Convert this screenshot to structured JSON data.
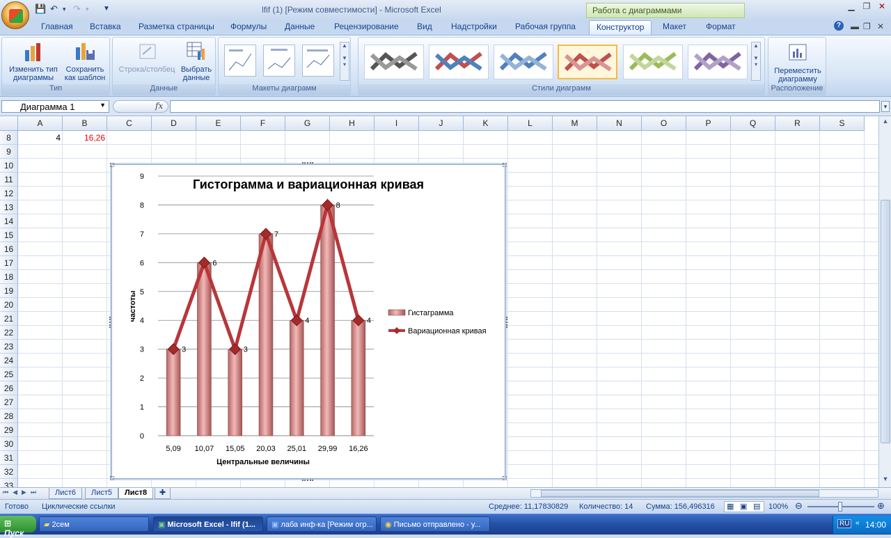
{
  "title_bar": {
    "window_title": "lfif (1)  [Режим совместимости] - Microsoft Excel",
    "context_header": "Работа с диаграммами"
  },
  "tabs": [
    "Главная",
    "Вставка",
    "Разметка страницы",
    "Формулы",
    "Данные",
    "Рецензирование",
    "Вид",
    "Надстройки",
    "Рабочая группа",
    "Конструктор",
    "Макет",
    "Формат"
  ],
  "ribbon": {
    "type_group": {
      "label": "Тип",
      "change_type": "Изменить тип\nдиаграммы",
      "save_template": "Сохранить\nкак шаблон"
    },
    "data_group": {
      "label": "Данные",
      "switch_row_col": "Строка/столбец",
      "select_data": "Выбрать\nданные"
    },
    "layouts_group": {
      "label": "Макеты диаграмм"
    },
    "styles_group": {
      "label": "Стили диаграмм",
      "style_colors": [
        "#555555",
        "#c0504d",
        "#4f81bd",
        "#c0504d",
        "#9bbb59",
        "#8064a2"
      ]
    },
    "location_group": {
      "label": "Расположение",
      "move_chart": "Переместить\nдиаграмму"
    }
  },
  "formula_bar": {
    "name_box": "Диаграмма 1",
    "fx": "fx"
  },
  "columns": [
    "A",
    "B",
    "C",
    "D",
    "E",
    "F",
    "G",
    "H",
    "I",
    "J",
    "K",
    "L",
    "M",
    "N",
    "O",
    "P",
    "Q",
    "R",
    "S"
  ],
  "rows": [
    "8",
    "9",
    "10",
    "11",
    "12",
    "13",
    "14",
    "15",
    "16",
    "17",
    "18",
    "19",
    "20",
    "21",
    "22",
    "23",
    "24",
    "25",
    "26",
    "27",
    "28",
    "29",
    "30",
    "31",
    "32",
    "33"
  ],
  "cells": {
    "A8": "4",
    "B8": "16,26"
  },
  "chart_data": {
    "type": "bar",
    "title": "Гистограмма и вариационная кривая",
    "xlabel": "Центральные величины",
    "ylabel": "частоты",
    "categories": [
      "5,09",
      "10,07",
      "15,05",
      "20,03",
      "25,01",
      "29,99",
      "16,26"
    ],
    "series": [
      {
        "name": "Гистаграмма",
        "type": "bar",
        "values": [
          3,
          6,
          3,
          7,
          4,
          8,
          4
        ],
        "color": "#d99594"
      },
      {
        "name": "Вариационная кривая",
        "type": "line",
        "values": [
          3,
          6,
          3,
          7,
          4,
          8,
          4
        ],
        "color": "#b8363a"
      }
    ],
    "ylim": [
      0,
      9
    ],
    "yticks": [
      "0",
      "1",
      "2",
      "3",
      "4",
      "5",
      "6",
      "7",
      "8",
      "9"
    ],
    "grid": true,
    "legend_position": "right"
  },
  "sheet_tabs": [
    "Лист6",
    "Лист5",
    "Лист8"
  ],
  "status_bar": {
    "ready": "Готово",
    "circular": "Циклические ссылки",
    "average": "Среднее: 11,17830829",
    "count": "Количество: 14",
    "sum": "Сумма: 156,496316",
    "zoom": "100%"
  },
  "taskbar": {
    "start": "Пуск",
    "items": [
      "2сем",
      "Microsoft Excel - lfif (1...",
      "лаба инф-ка [Режим огр...",
      "Письмо отправлено - у..."
    ],
    "lang": "RU",
    "clock": "14:00"
  }
}
